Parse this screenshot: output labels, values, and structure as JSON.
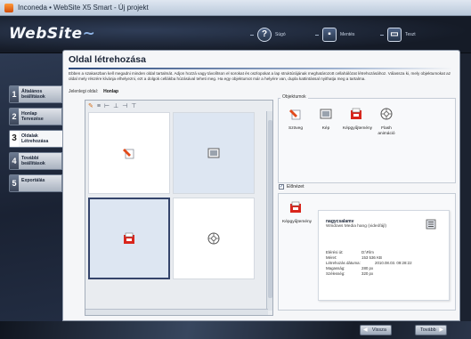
{
  "window": {
    "title": "Inconeda • WebSite X5 Smart - Új projekt"
  },
  "header": {
    "logo": "WebSite",
    "buttons": [
      {
        "label": "Súgó",
        "icon": "help-icon"
      },
      {
        "label": "Mentés",
        "icon": "save-icon"
      },
      {
        "label": "Teszt",
        "icon": "preview-icon"
      }
    ]
  },
  "steps": [
    {
      "num": "1",
      "label": "Általános\nbeállítások"
    },
    {
      "num": "2",
      "label": "Honlap\nTervezése"
    },
    {
      "num": "3",
      "label": "Oldalak\nLétrehozása"
    },
    {
      "num": "4",
      "label": "További\nbeállítások"
    },
    {
      "num": "5",
      "label": "Exportálás"
    }
  ],
  "main": {
    "title": "Oldal létrehozása",
    "description": "Ebben a szakaszban kell megadni minden oldal tartalmát. Adjon hozzá vagy távolítson el sorokat és oszlopokat a lap struktúrájának meghatározott cellahálózat létrehozásához. Válassza ki, mely objektumokat az oldal mely részére kívánja elhelyezni, ezt a dolgok cellákba húzásával teheti meg. Ha egy objektumot már a helyére van, dupla kattintással nyithatja meg a tartalma.",
    "layout_label": "Jelenlegi oldal:",
    "layout_value": "Honlap",
    "objects_label": "Objektumok",
    "objects": [
      {
        "label": "Szöveg",
        "icon": "text-icon"
      },
      {
        "label": "Kép",
        "icon": "image-icon"
      },
      {
        "label": "Képgyűjtemény",
        "icon": "gallery-icon"
      },
      {
        "label": "Flash\nanimáció",
        "icon": "flash-icon"
      }
    ],
    "preview_label": "Előnézet",
    "preview_checked": true,
    "preview": {
      "type_label": "Képgyűjtemény",
      "name": "nagycsalamv",
      "subtitle": "Windows Media hang (videófájl)",
      "props": [
        {
          "k": "Elérési út:",
          "v": "D:\\Film"
        },
        {
          "k": "Méret:",
          "v": "153 536 KB"
        },
        {
          "k": "Létrehozás dátuma:",
          "v": "2010.08.03. 09:28:22"
        },
        {
          "k": "Magasság:",
          "v": "280 px"
        },
        {
          "k": "Szélesség:",
          "v": "320 px"
        }
      ]
    }
  },
  "footer": {
    "back_label": "Vissza",
    "next_label": "Tovább"
  }
}
